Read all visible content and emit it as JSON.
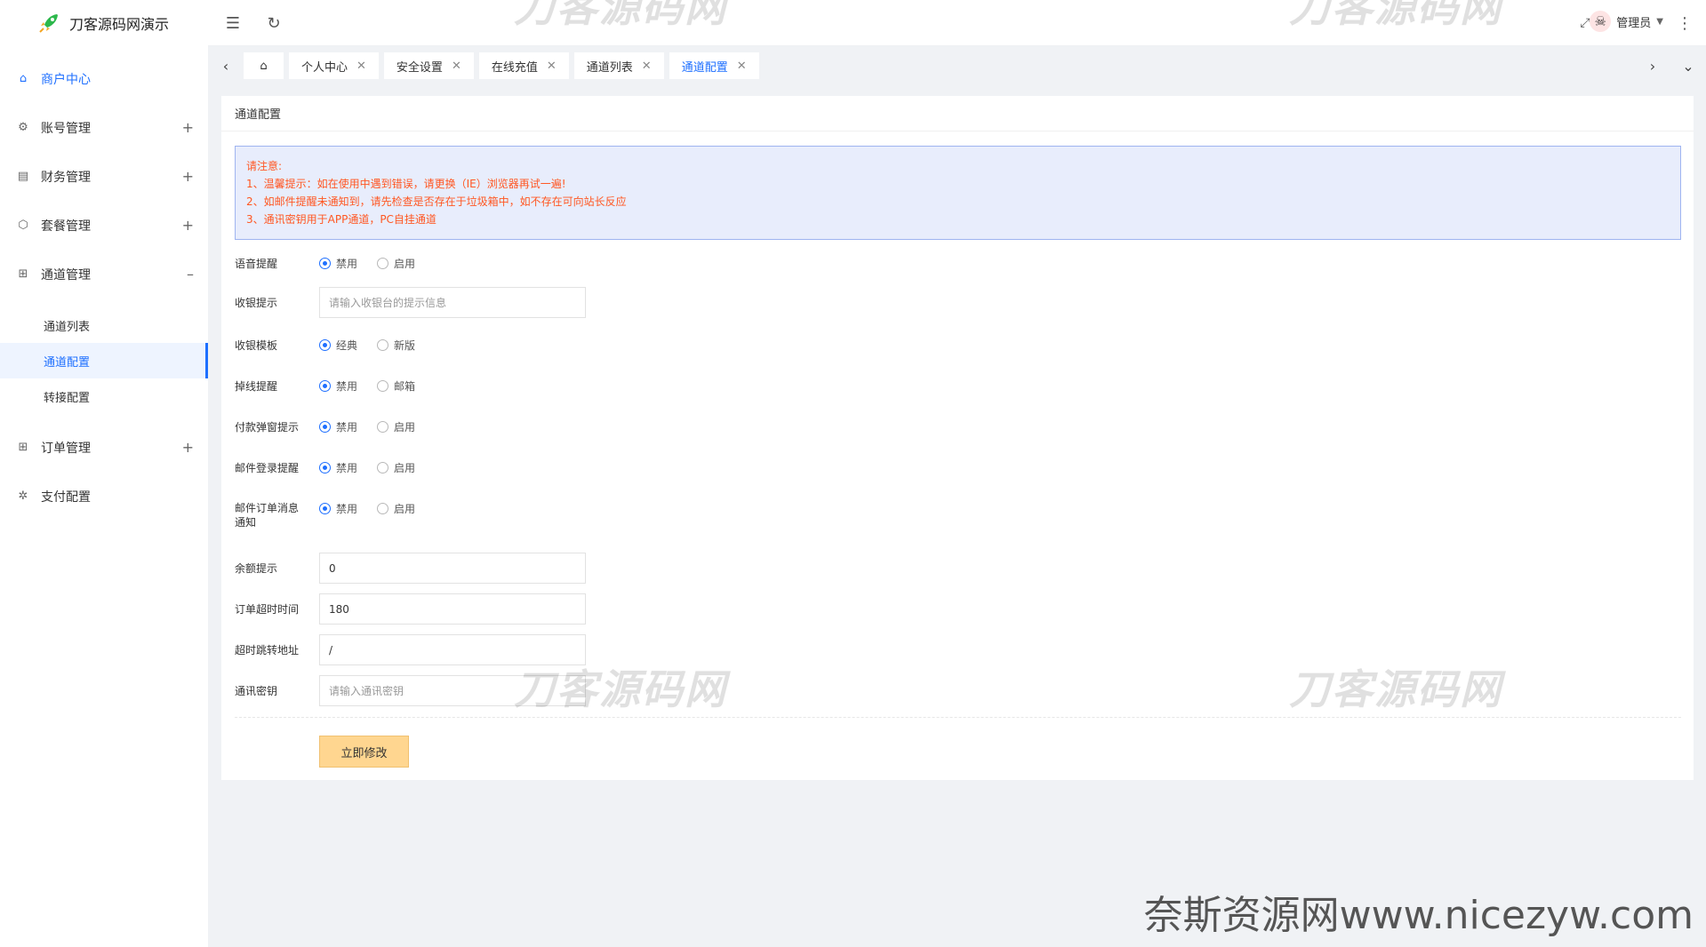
{
  "brand": {
    "title": "刀客源码网演示"
  },
  "sidebar": {
    "items": [
      {
        "label": "商户中心",
        "icon": "home-icon",
        "toggle": ""
      },
      {
        "label": "账号管理",
        "icon": "gear-icon",
        "toggle": "+"
      },
      {
        "label": "财务管理",
        "icon": "wallet-icon",
        "toggle": "+"
      },
      {
        "label": "套餐管理",
        "icon": "cube-icon",
        "toggle": "+"
      },
      {
        "label": "通道管理",
        "icon": "grid-icon",
        "toggle": "–"
      },
      {
        "label": "订单管理",
        "icon": "grid-icon",
        "toggle": "+"
      },
      {
        "label": "支付配置",
        "icon": "cog-icon",
        "toggle": ""
      }
    ],
    "sub_items": [
      "通道列表",
      "通道配置",
      "转接配置"
    ]
  },
  "header": {
    "user_name": "管理员"
  },
  "tabs": [
    {
      "label": "个人中心"
    },
    {
      "label": "安全设置"
    },
    {
      "label": "在线充值"
    },
    {
      "label": "通道列表"
    },
    {
      "label": "通道配置"
    }
  ],
  "card": {
    "title": "通道配置",
    "notice": {
      "heading": "请注意:",
      "lines": [
        "1、温馨提示：如在使用中遇到错误，请更换（IE）浏览器再试一遍!",
        "2、如邮件提醒未通知到，请先检查是否存在于垃圾箱中，如不存在可向站长反应",
        "3、通讯密钥用于APP通道，PC自挂通道"
      ]
    },
    "form": {
      "voice": {
        "label": "语音提醒",
        "opt1": "禁用",
        "opt2": "启用"
      },
      "cashier_tip": {
        "label": "收银提示",
        "placeholder": "请输入收银台的提示信息"
      },
      "template": {
        "label": "收银模板",
        "opt1": "经典",
        "opt2": "新版"
      },
      "offline": {
        "label": "掉线提醒",
        "opt1": "禁用",
        "opt2": "邮箱"
      },
      "popup": {
        "label": "付款弹窗提示",
        "opt1": "禁用",
        "opt2": "启用"
      },
      "mail_login": {
        "label": "邮件登录提醒",
        "opt1": "禁用",
        "opt2": "启用"
      },
      "mail_order": {
        "label": "邮件订单消息通知",
        "opt1": "禁用",
        "opt2": "启用"
      },
      "balance": {
        "label": "余额提示",
        "value": "0"
      },
      "timeout": {
        "label": "订单超时时间",
        "value": "180"
      },
      "redirect": {
        "label": "超时跳转地址",
        "value": "/"
      },
      "secret": {
        "label": "通讯密钥",
        "placeholder": "请输入通讯密钥"
      }
    },
    "submit_label": "立即修改"
  },
  "watermarks": [
    "刀客源码网",
    "刀客源码网",
    "刀客源码网",
    "刀客源码网"
  ],
  "footer_mark": "奈斯资源网www.nicezyw.com"
}
